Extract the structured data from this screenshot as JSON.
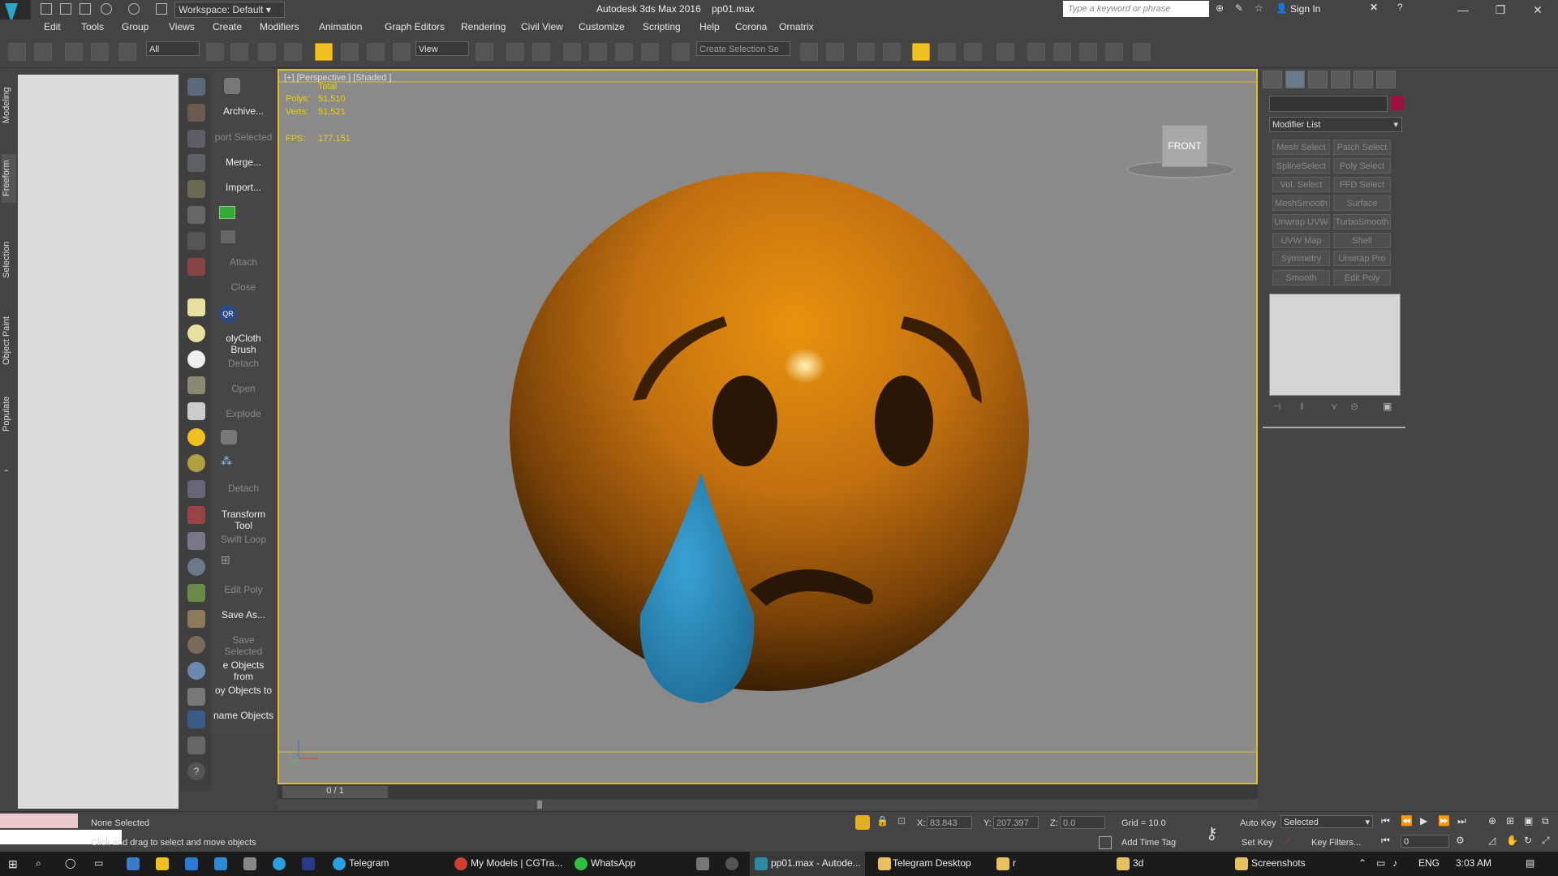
{
  "titlebar": {
    "workspace": "Workspace: Default",
    "title": "Autodesk 3ds Max 2016",
    "file": "pp01.max",
    "search_placeholder": "Type a keyword or phrase",
    "sign_in": "Sign In"
  },
  "menu": [
    "Edit",
    "Tools",
    "Group",
    "Views",
    "Create",
    "Modifiers",
    "Animation",
    "Graph Editors",
    "Rendering",
    "Civil View",
    "Customize",
    "Scripting",
    "Help",
    "Corona",
    "Ornatrix"
  ],
  "toolbar": {
    "filter": "All",
    "view": "View",
    "selection_set": "Create Selection Se"
  },
  "left_tabs": [
    "Modeling",
    "Freeform",
    "Selection",
    "Object Paint",
    "Populate"
  ],
  "script_buttons": [
    {
      "label": "Archive...",
      "dim": false
    },
    {
      "label": "port Selected",
      "dim": true
    },
    {
      "label": "Merge...",
      "dim": false
    },
    {
      "label": "Import...",
      "dim": false
    },
    {
      "label": "Attach",
      "dim": true
    },
    {
      "label": "Close",
      "dim": true
    },
    {
      "label": "olyCloth Brush",
      "dim": false
    },
    {
      "label": "Detach",
      "dim": true
    },
    {
      "label": "Open",
      "dim": true
    },
    {
      "label": "Explode",
      "dim": true
    },
    {
      "label": "Detach",
      "dim": true
    },
    {
      "label": "Transform Tool",
      "dim": false
    },
    {
      "label": "Swift Loop",
      "dim": true
    },
    {
      "label": "Edit Poly",
      "dim": true
    },
    {
      "label": "Save As...",
      "dim": false
    },
    {
      "label": "Save Selected",
      "dim": true
    },
    {
      "label": "e Objects from",
      "dim": false
    },
    {
      "label": "oy Objects to",
      "dim": false
    },
    {
      "label": "name Objects",
      "dim": false
    }
  ],
  "viewport": {
    "label": "[+] [Perspective ] [Shaded ]",
    "stats_total": "Total",
    "polys_label": "Polys:",
    "polys": "51,510",
    "verts_label": "Verts:",
    "verts": "51,521",
    "fps_label": "FPS:",
    "fps": "177.151",
    "viewcube": "FRONT",
    "frame": "0 / 1"
  },
  "modifiers": {
    "list_label": "Modifier List",
    "buttons": [
      "Mesh Select",
      "Patch Select",
      "SplineSelect",
      "Poly Select",
      "Vol. Select",
      "FFD Select",
      "MeshSmooth",
      "Surface Select",
      "Unwrap UVW",
      "TurboSmooth",
      "UVW Map",
      "Shell",
      "Symmetry",
      "Unwrap Pro",
      "Smooth",
      "Edit Poly"
    ]
  },
  "status": {
    "selection": "None Selected",
    "hint": "Click and drag to select and move objects",
    "x_label": "X:",
    "x": "83.843",
    "y_label": "Y:",
    "y": "207.397",
    "z_label": "Z:",
    "z": "0.0",
    "grid": "Grid = 10.0",
    "add_time_tag": "Add Time Tag",
    "auto_key": "Auto Key",
    "set_key": "Set Key",
    "selected": "Selected",
    "key_filters": "Key Filters...",
    "frame_field": "0"
  },
  "taskbar": {
    "items": [
      "Telegram",
      "My Models | CGTra...",
      "WhatsApp",
      "pp01.max - Autode...",
      "Telegram Desktop",
      "r",
      "3d",
      "Screenshots"
    ],
    "lang": "ENG",
    "time": "3:03 AM"
  },
  "colors": {
    "accent": "#e0c020",
    "emoji": "#d88a10",
    "tear": "#2a8fc0"
  }
}
